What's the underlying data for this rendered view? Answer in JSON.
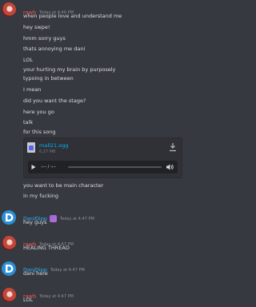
{
  "groups": [
    {
      "id": "g1",
      "user": "rawb",
      "time": "Today at 4:46 PM",
      "lines": [
        "when people love and understand me",
        "hey swpe!",
        "hmm sorry guys",
        "thats annoying me dani",
        "LOL",
        "your hurting my brain by purposely",
        "typoing in between",
        "I mean",
        "did you want the stage?",
        "here you go",
        "talk",
        "for this song"
      ]
    },
    {
      "id": "g2",
      "user": "DaniDipp",
      "time": "Today at 4:47 PM",
      "lines": [
        "hey guys"
      ]
    },
    {
      "id": "g3",
      "user": "rawb",
      "time": "Today at 4:47 PM",
      "lines": [
        "HEALING THREAD"
      ]
    },
    {
      "id": "g4",
      "user": "DaniDipp",
      "time": "Today at 4:47 PM",
      "lines": [
        "dani here"
      ]
    },
    {
      "id": "g5",
      "user": "rawb",
      "time": "Today at 4:47 PM",
      "lines": [
        "LOL"
      ]
    }
  ],
  "after_attachment_lines": [
    "you want to be main character",
    "in my fucking"
  ],
  "attachment": {
    "filename": "mall21.ogg",
    "size": "6.27 MB",
    "timer": "-:-- / -:--",
    "progress": 0
  },
  "icons": {
    "file": "audio-file-icon",
    "download": "download-icon",
    "play": "play-icon",
    "volume": "volume-icon",
    "badge": "role-badge-icon"
  },
  "colors": {
    "background": "#36393f",
    "rawb_name": "#ff5a5a",
    "dani_name": "#2fb4ff",
    "link": "#00aff4"
  }
}
